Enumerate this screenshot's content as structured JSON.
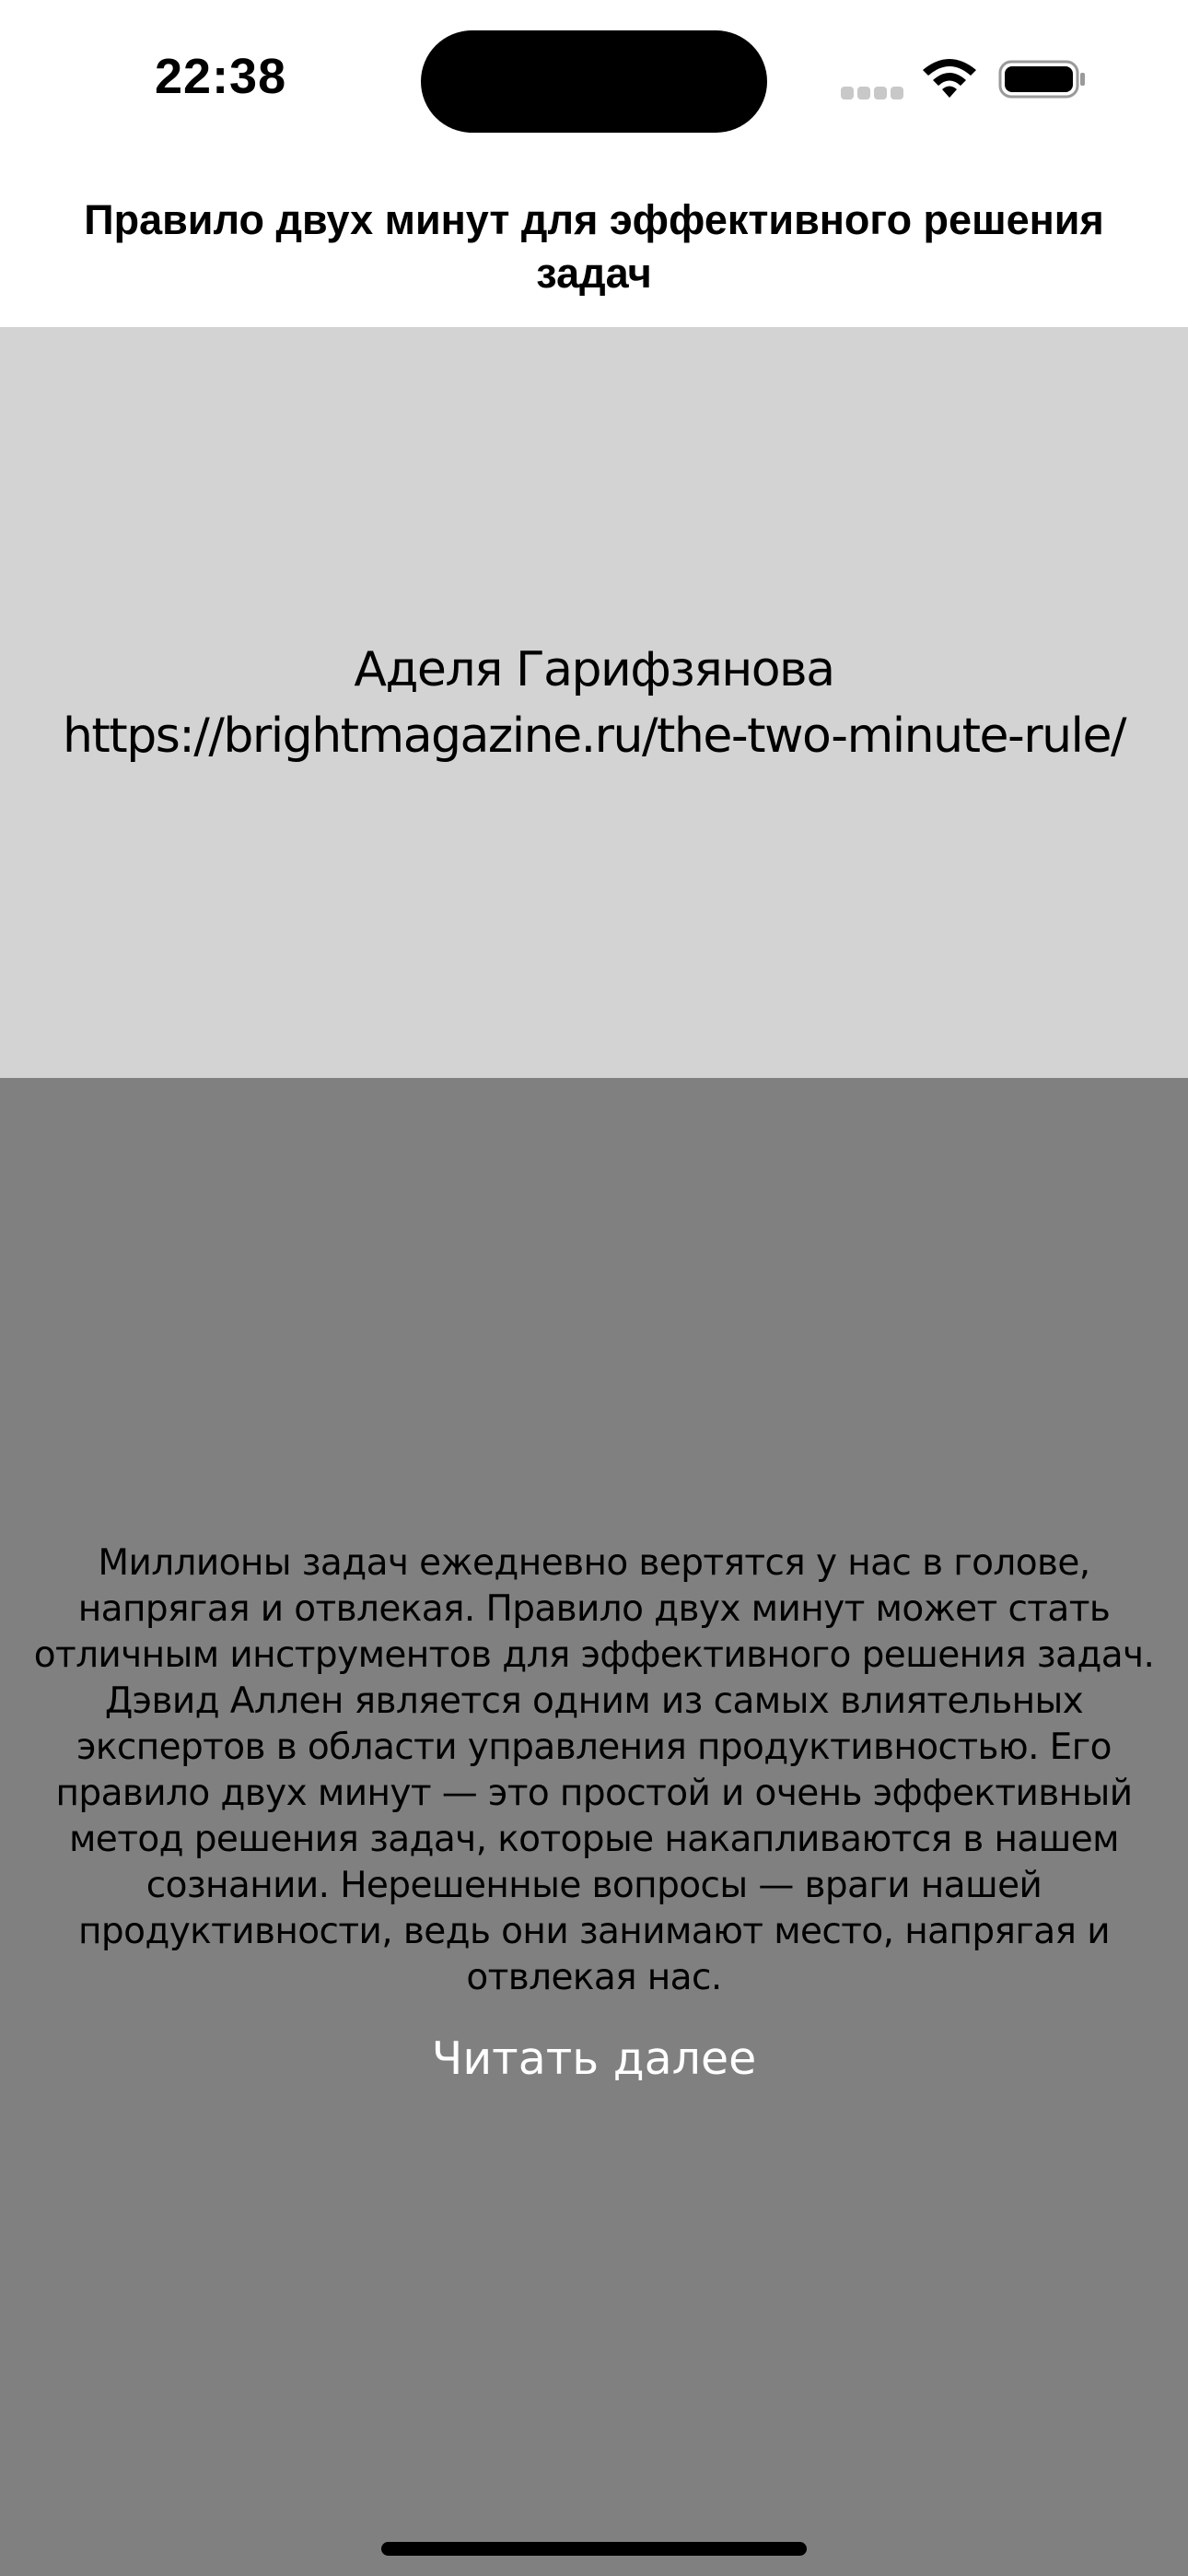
{
  "status_bar": {
    "time": "22:38",
    "icons": [
      "cellular-signal-icon",
      "wifi-icon",
      "battery-icon"
    ]
  },
  "header": {
    "title": "Правило двух минут для эффективного решения задач"
  },
  "source": {
    "author": "Аделя Гарифзянова",
    "url": "https://brightmagazine.ru/the-two-minute-rule/"
  },
  "article": {
    "summary": "Миллионы задач ежедневно вертятся у нас в голове, напрягая и отвлекая. Правило двух минут может стать отличным инструментов для эффективного решения задач. Дэвид Аллен является одним из самых влиятельных экспертов в области управления продуктивностью. Его правило двух минут — это простой и очень эффективный метод решения задач, которые накапливаются в нашем сознании. Нерешенные вопросы — враги нашей продуктивности, ведь они занимают место, напрягая и отвлекая нас.",
    "read_more_label": "Читать далее"
  },
  "colors": {
    "source_background": "#d3d3d3",
    "summary_background": "#808080",
    "read_more_text": "#ffffff"
  }
}
